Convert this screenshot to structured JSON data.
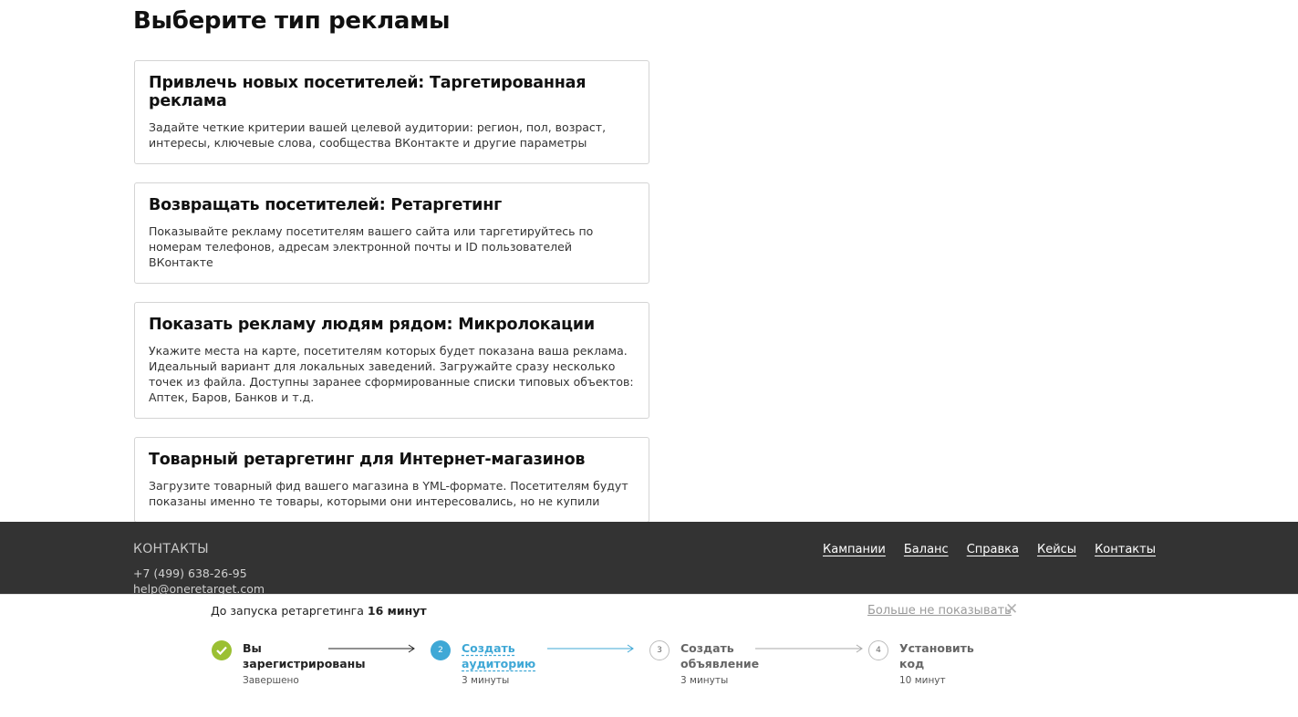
{
  "page": {
    "title": "Выберите тип рекламы"
  },
  "cards": [
    {
      "title": "Привлечь новых посетителей: Таргетированная реклама",
      "description": "Задайте четкие критерии вашей целевой аудитории: регион, пол, возраст, интересы, ключевые слова, сообщества ВКонтакте и другие параметры"
    },
    {
      "title": "Возвращать посетителей: Ретаргетинг",
      "description": "Показывайте рекламу посетителям вашего сайта или таргетируйтесь по номерам телефонов, адресам электронной почты и ID пользователей ВКонтакте"
    },
    {
      "title": "Показать рекламу людям рядом: Микролокации",
      "description": "Укажите места на карте, посетителям которых будет показана ваша реклама. Идеальный вариант для локальных заведений. Загружайте сразу несколько точек из файла. Доступны заранее сформированные списки типовых объектов: Аптек, Баров, Банков и т.д."
    },
    {
      "title": "Товарный ретаргетинг для Интернет-магазинов",
      "description": "Загрузите товарный фид вашего магазина в YML-формате. Посетителям будут показаны именно те товары, которыми они интересовались, но не купили"
    }
  ],
  "footer": {
    "heading": "КОНТАКТЫ",
    "phone": "+7 (499) 638-26-95",
    "email": "help@oneretarget.com",
    "nav": [
      "Кампании",
      "Баланс",
      "Справка",
      "Кейсы",
      "Контакты"
    ]
  },
  "onboarding": {
    "countdown_prefix": "До запуска ретаргетинга",
    "countdown_value": "16 минут",
    "dismiss_label": "Больше не показывать",
    "close_symbol": "✕",
    "steps": [
      {
        "number": "✓",
        "title_line1": "Вы",
        "title_line2": "зарегистрированы",
        "subtitle": "Завершено",
        "state": "done"
      },
      {
        "number": "2",
        "title_line1": "Создать аудиторию",
        "title_line2": "",
        "subtitle": "3 минуты",
        "state": "active"
      },
      {
        "number": "3",
        "title_line1": "Создать",
        "title_line2": "объявление",
        "subtitle": "3 минуты",
        "state": "pending"
      },
      {
        "number": "4",
        "title_line1": "Установить",
        "title_line2": "код",
        "subtitle": "10 минут",
        "state": "pending"
      }
    ],
    "colors": {
      "done": "#9bc033",
      "active": "#3fa8d6",
      "pending": "#bdbdbd"
    }
  }
}
